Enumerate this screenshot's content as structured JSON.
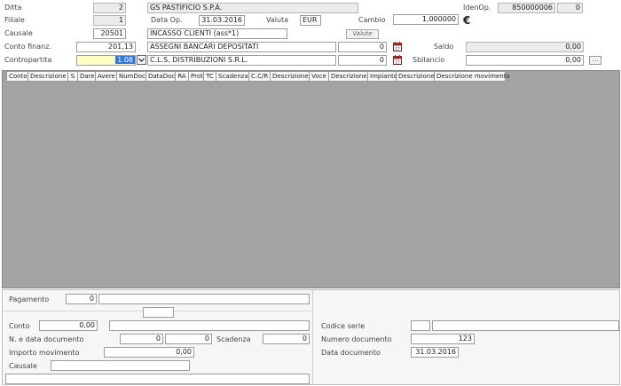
{
  "header": {
    "ditta": {
      "label": "Ditta",
      "code": "2",
      "name": "GS PASTIFICIO S.P.A."
    },
    "filiale": {
      "label": "Filiale",
      "code": "1"
    },
    "data_op": {
      "label": "Data Op.",
      "value": "31.03.2016"
    },
    "valuta": {
      "label": "Valuta",
      "value": "EUR"
    },
    "cambio": {
      "label": "Cambio",
      "value": "1,000000"
    },
    "currency_symbol": "€",
    "idenop": {
      "label": "IdenOp.",
      "value": "850000006",
      "extra": "0"
    },
    "causale": {
      "label": "Causale",
      "code": "20501",
      "description": "INCASSO CLIENTI (ass*1)"
    },
    "valute_button": "Valute",
    "conto_finanz": {
      "label": "Conto finanz.",
      "code": "201,13",
      "description": "ASSEGNI BANCARI DEPOSITATI",
      "amount": "0"
    },
    "saldo": {
      "label": "Saldo",
      "value": "0,00"
    },
    "contropartita": {
      "label": "Contropartita",
      "code": "1.08",
      "description": "C.L.S. DISTRIBUZIONI S.R.L.",
      "amount": "0"
    },
    "sbilancio": {
      "label": "Sbilancio",
      "value": "0,00"
    }
  },
  "grid": {
    "columns": [
      "Conto",
      "Descrizione",
      "S",
      "Dare",
      "Avere",
      "NumDoc",
      "DataDoc",
      "RA",
      "Prot",
      "TC",
      "Scadenza",
      "C.C/R",
      "Descrizione",
      "Voce",
      "Descrizione",
      "Impianto",
      "Descrizione",
      "Descrizione movimento"
    ]
  },
  "bottom": {
    "pagamento": {
      "label": "Pagamento",
      "code": "0",
      "description": ""
    },
    "conto": {
      "label": "Conto",
      "value": "0,00",
      "description": ""
    },
    "n_data_doc": {
      "label": "N. e data documento",
      "num": "0",
      "date": "0"
    },
    "scadenza": {
      "label": "Scadenza",
      "value": "0"
    },
    "importo": {
      "label": "Importo movimento",
      "value": "0,00"
    },
    "causale": {
      "label": "Causale",
      "value": ""
    },
    "codice_serie": {
      "label": "Codice serie",
      "code": "",
      "description": ""
    },
    "numero_documento": {
      "label": "Numero documento",
      "value": "123"
    },
    "data_documento": {
      "label": "Data documento",
      "value": "31.03.2016"
    }
  }
}
